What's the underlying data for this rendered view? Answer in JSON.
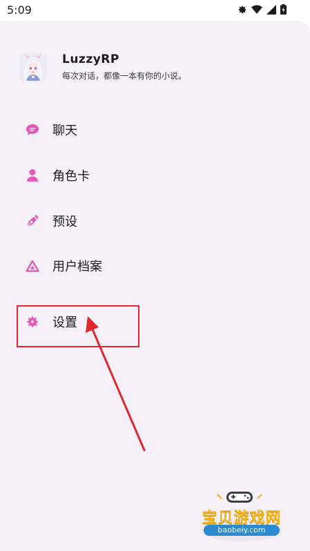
{
  "status_bar": {
    "time": "5:09",
    "icons": [
      "settings-gear-icon",
      "wifi-icon",
      "signal-icon",
      "battery-charging-icon"
    ]
  },
  "profile": {
    "app_name": "LuzzyRP",
    "tagline": "每次对话，都像一本有你的小说。"
  },
  "nav": {
    "items": [
      {
        "label": "聊天",
        "icon": "chat-bubble-icon"
      },
      {
        "label": "角色卡",
        "icon": "person-icon"
      },
      {
        "label": "预设",
        "icon": "pen-nib-icon"
      },
      {
        "label": "用户档案",
        "icon": "triangle-icon"
      },
      {
        "label": "设置",
        "icon": "gear-icon"
      }
    ]
  },
  "annotation": {
    "color": "#e3252c",
    "target": "设置"
  },
  "watermark": {
    "title": "宝贝游戏网",
    "url": "baobeiy.com"
  },
  "colors": {
    "drawer_bg": "#f6f0f8",
    "icon_accent": "#e35bb9",
    "text": "#1d1b20"
  }
}
